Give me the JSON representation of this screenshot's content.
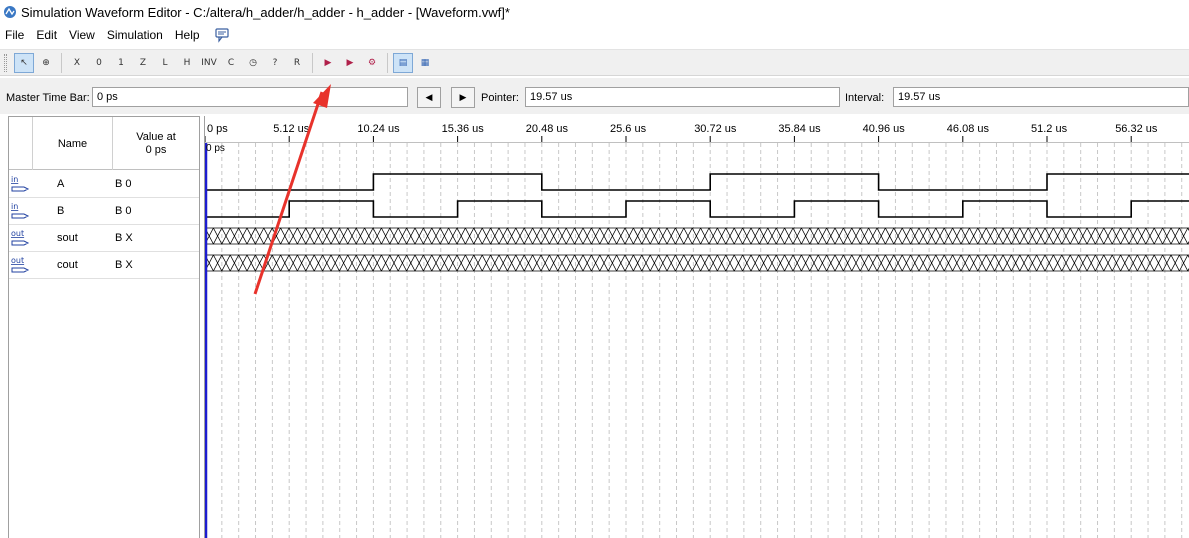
{
  "window": {
    "title": "Simulation Waveform Editor - C:/altera/h_adder/h_adder - h_adder - [Waveform.vwf]*"
  },
  "menu": {
    "items": [
      "File",
      "Edit",
      "View",
      "Simulation",
      "Help"
    ]
  },
  "toolbar": {
    "buttons": [
      {
        "name": "selection-tool-icon",
        "glyph": "↖"
      },
      {
        "name": "zoom-tool-icon",
        "glyph": "⊕"
      },
      {
        "name": "force-unknown-icon",
        "glyph": "X"
      },
      {
        "name": "force-low-icon",
        "glyph": "0"
      },
      {
        "name": "force-high-icon",
        "glyph": "1"
      },
      {
        "name": "force-high-impedance-icon",
        "glyph": "Z"
      },
      {
        "name": "force-weak-low-icon",
        "glyph": "L"
      },
      {
        "name": "force-weak-high-icon",
        "glyph": "H"
      },
      {
        "name": "invert-icon",
        "glyph": "INV"
      },
      {
        "name": "count-value-icon",
        "glyph": "C"
      },
      {
        "name": "clock-icon",
        "glyph": "◷"
      },
      {
        "name": "arbitrary-value-icon",
        "glyph": "?"
      },
      {
        "name": "random-value-icon",
        "glyph": "R"
      },
      {
        "name": "run-functional-simulation-icon",
        "glyph": "▶"
      },
      {
        "name": "run-timing-simulation-icon",
        "glyph": "▶"
      },
      {
        "name": "generate-netlist-icon",
        "glyph": "⚙"
      },
      {
        "name": "waveform-view-icon",
        "glyph": "▤"
      },
      {
        "name": "snap-to-grid-icon",
        "glyph": "▦"
      }
    ]
  },
  "timebar": {
    "master_label": "Master Time Bar:",
    "master_value": "0 ps",
    "pointer_label": "Pointer:",
    "pointer_value": "19.57 us",
    "interval_label": "Interval:",
    "interval_value": "19.57 us",
    "prev_glyph": "◀",
    "next_glyph": "▶"
  },
  "signal_table": {
    "name_header": "Name",
    "value_header_line1": "Value at",
    "value_header_line2": "0 ps",
    "signals": [
      {
        "direction": "in",
        "name": "A",
        "value": "B 0",
        "kind": "clock",
        "period_us": 20.48,
        "initial": 0
      },
      {
        "direction": "in",
        "name": "B",
        "value": "B 0",
        "kind": "clock",
        "period_us": 10.24,
        "initial": 0
      },
      {
        "direction": "out",
        "name": "sout",
        "value": "B X",
        "kind": "unknown"
      },
      {
        "direction": "out",
        "name": "cout",
        "value": "B X",
        "kind": "unknown"
      }
    ]
  },
  "ruler": {
    "ticks": [
      "0 ps",
      "5.12 us",
      "10.24 us",
      "15.36 us",
      "20.48 us",
      "25.6 us",
      "30.72 us",
      "35.84 us",
      "40.96 us",
      "46.08 us",
      "51.2 us",
      "56.32 us"
    ],
    "tick_step_us": 5.12,
    "cursor_label": "0 ps"
  },
  "colors": {
    "master_bar": "#1c1cd0",
    "annotation_arrow": "#e8322b",
    "grid_line": "#c8c8c8",
    "waveform": "#000000"
  }
}
